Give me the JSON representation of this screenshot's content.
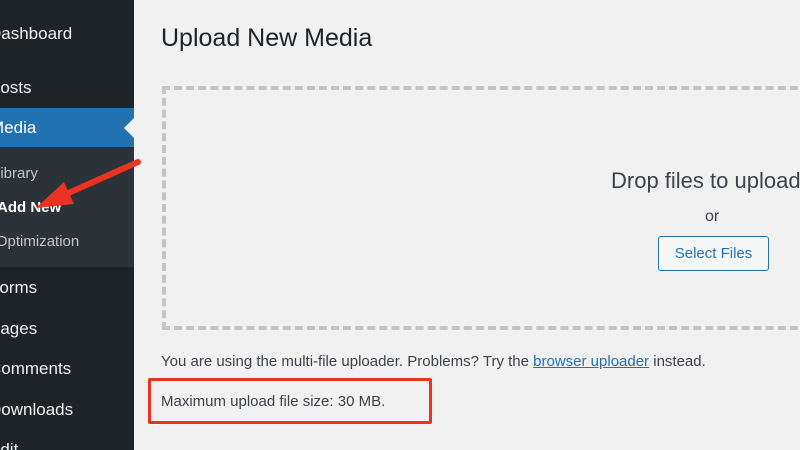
{
  "sidebar": {
    "items_top": [
      {
        "label": "Dashboard"
      },
      {
        "label": "Posts"
      },
      {
        "label": "Media"
      }
    ],
    "media_submenu": [
      {
        "label": "Library"
      },
      {
        "label": "Add New"
      },
      {
        "label": "Image Optimization"
      }
    ],
    "items_bottom": [
      {
        "label": "Forms"
      },
      {
        "label": "Pages"
      },
      {
        "label": "Comments"
      },
      {
        "label": "Downloads"
      },
      {
        "label": "Edit"
      }
    ]
  },
  "main": {
    "title": "Upload New Media",
    "drop_zone": {
      "instructions": "Drop files to upload",
      "or": "or",
      "select_button": "Select Files"
    },
    "uploader_note": {
      "before": "You are using the multi-file uploader. Problems? Try the ",
      "link": "browser uploader",
      "after": " instead."
    },
    "max_upload_size": "Maximum upload file size: 30 MB."
  },
  "colors": {
    "sidebar_bg": "#1d2327",
    "active_bg": "#2271b1",
    "annotation_red": "#ea3323"
  }
}
